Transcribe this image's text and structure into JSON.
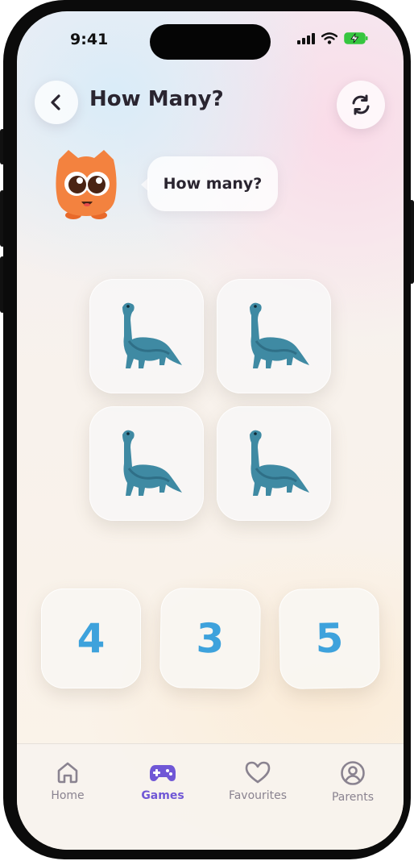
{
  "status_bar": {
    "time": "9:41"
  },
  "header": {
    "title": "How Many?",
    "back_icon": "chevron-left-icon",
    "refresh_icon": "refresh-icon"
  },
  "prompt": {
    "text": "How many?"
  },
  "mascot": {
    "icon": "owl-mascot",
    "color": "#f3823f"
  },
  "items": {
    "icon": "dinosaur-icon",
    "tiles": [
      "dinosaur",
      "dinosaur",
      "dinosaur",
      "dinosaur"
    ]
  },
  "answers": [
    "4",
    "3",
    "5"
  ],
  "tabbar": {
    "items": [
      {
        "label": "Home",
        "icon": "home-icon"
      },
      {
        "label": "Games",
        "icon": "gamepad-icon",
        "active": true
      },
      {
        "label": "Favourites",
        "icon": "heart-icon"
      },
      {
        "label": "Parents",
        "icon": "user-icon"
      }
    ]
  },
  "colors": {
    "accent": "#7057d6",
    "answer_text": "#3ea2dc",
    "dino": "#3f8aa3"
  }
}
